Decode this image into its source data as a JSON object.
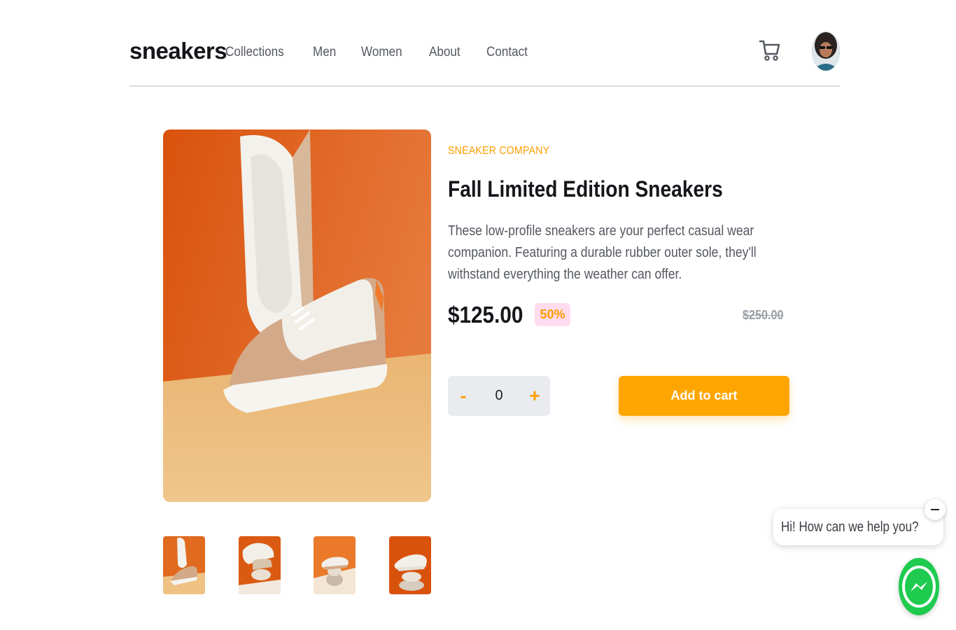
{
  "header": {
    "logo": "sneakers",
    "nav": [
      "Collections",
      "Men",
      "Women",
      "About",
      "Contact"
    ]
  },
  "product": {
    "company": "SNEAKER COMPANY",
    "title": "Fall Limited Edition Sneakers",
    "description": "These low-profile sneakers are your perfect casual wear companion. Featuring a durable rubber outer sole, they'll withstand everything the weather can offer.",
    "price": "$125.00",
    "discount": "50%",
    "original_price": "$250.00"
  },
  "cart_controls": {
    "minus": "-",
    "quantity": "0",
    "plus": "+",
    "add_label": "Add to cart"
  },
  "chat": {
    "greeting": "Hi! How can we help you?"
  },
  "colors": {
    "accent": "#ffa500",
    "discount_bg": "#ffdcf0",
    "messenger": "#1ecb4f"
  }
}
